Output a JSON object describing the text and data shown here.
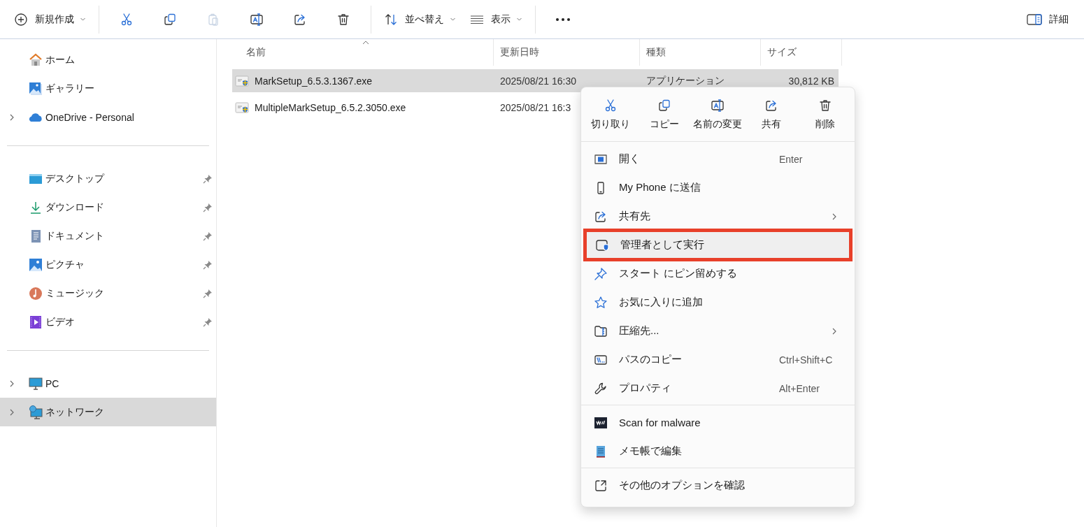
{
  "toolbar": {
    "new": {
      "label": "新規作成"
    },
    "actions": [
      {
        "disabled": false
      },
      {
        "disabled": false
      },
      {
        "disabled": true
      },
      {
        "disabled": false
      },
      {
        "disabled": false
      },
      {
        "disabled": false
      }
    ],
    "sort": {
      "label": "並べ替え"
    },
    "view": {
      "label": "表示"
    },
    "details": {
      "label": "詳細"
    }
  },
  "sidebar": {
    "groups": [
      [
        {
          "label": "ホーム",
          "expandable": false,
          "pinned": false,
          "selected": false
        },
        {
          "label": "ギャラリー",
          "expandable": false,
          "pinned": false,
          "selected": false
        },
        {
          "label": "OneDrive - Personal",
          "expandable": true,
          "pinned": false,
          "selected": false
        }
      ],
      [
        {
          "label": "デスクトップ",
          "expandable": false,
          "pinned": true,
          "selected": false
        },
        {
          "label": "ダウンロード",
          "expandable": false,
          "pinned": true,
          "selected": false
        },
        {
          "label": "ドキュメント",
          "expandable": false,
          "pinned": true,
          "selected": false
        },
        {
          "label": "ピクチャ",
          "expandable": false,
          "pinned": true,
          "selected": false
        },
        {
          "label": "ミュージック",
          "expandable": false,
          "pinned": true,
          "selected": false
        },
        {
          "label": "ビデオ",
          "expandable": false,
          "pinned": true,
          "selected": false
        }
      ],
      [
        {
          "label": "PC",
          "expandable": true,
          "pinned": false,
          "selected": false
        },
        {
          "label": "ネットワーク",
          "expandable": true,
          "pinned": false,
          "selected": true
        }
      ]
    ]
  },
  "table": {
    "columns": [
      {
        "label": "名前",
        "sorted": true
      },
      {
        "label": "更新日時",
        "sorted": false
      },
      {
        "label": "種類",
        "sorted": false
      },
      {
        "label": "サイズ",
        "sorted": false
      }
    ],
    "rows": [
      {
        "name": "MarkSetup_6.5.3.1367.exe",
        "date": "2025/08/21 16:30",
        "type": "アプリケーション",
        "size": "30,812 KB",
        "selected": true
      },
      {
        "name": "MultipleMarkSetup_6.5.2.3050.exe",
        "date": "2025/08/21 16:3",
        "selected": false
      }
    ]
  },
  "context_menu": {
    "quick_actions": [
      "切り取り",
      "コピー",
      "名前の変更",
      "共有",
      "削除"
    ],
    "sections": [
      [
        {
          "label": "開く",
          "shortcut": "Enter",
          "submenu": false,
          "highlighted": false
        },
        {
          "label": "My Phone に送信",
          "submenu": false,
          "highlighted": false
        },
        {
          "label": "共有先",
          "submenu": true,
          "highlighted": false
        },
        {
          "label": "管理者として実行",
          "submenu": false,
          "highlighted": true
        },
        {
          "label": "スタート にピン留めする",
          "submenu": false,
          "highlighted": false
        },
        {
          "label": "お気に入りに追加",
          "submenu": false,
          "highlighted": false
        },
        {
          "label": "圧縮先...",
          "submenu": true,
          "highlighted": false
        },
        {
          "label": "パスのコピー",
          "shortcut": "Ctrl+Shift+C",
          "submenu": false,
          "highlighted": false
        },
        {
          "label": "プロパティ",
          "shortcut": "Alt+Enter",
          "submenu": false,
          "highlighted": false
        }
      ],
      [
        {
          "label": "Scan for malware",
          "submenu": false,
          "highlighted": false
        },
        {
          "label": "メモ帳で編集",
          "submenu": false,
          "highlighted": false
        }
      ],
      [
        {
          "label": "その他のオプションを確認",
          "submenu": false,
          "highlighted": false
        }
      ]
    ]
  }
}
